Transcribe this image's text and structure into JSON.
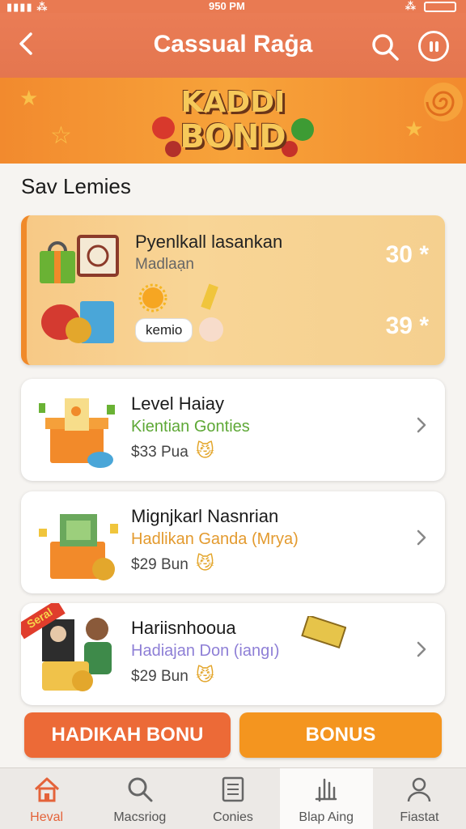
{
  "status_bar": {
    "time": "950 PM"
  },
  "header": {
    "title": "Cassual Raġa"
  },
  "banner": {
    "logo_line1": "KADDI",
    "logo_line2": "BOND"
  },
  "section_title": "Sav Lemies",
  "featured": {
    "title": "Pyenlkall lasankan",
    "subtitle": "Madlaạn",
    "chip_label": "kemio",
    "value_top": "30 *",
    "value_bottom": "39 *"
  },
  "offers": [
    {
      "title": "Level Haiay",
      "subtitle": "Kientian Gonties",
      "subtitle_color": "#5ea836",
      "price": "$33 Pua"
    },
    {
      "title": "Mignjkarl Nasnrian",
      "subtitle": "Hadlikan Ganda (Mrya)",
      "subtitle_color": "#e39a2e",
      "price": "$29 Bun"
    },
    {
      "title": "Hariisnhooua",
      "subtitle": "Hadiajan Don (iangı)",
      "subtitle_color": "#8e7fd6",
      "price": "$29 Bun",
      "ribbon": "Seral"
    }
  ],
  "buttons": {
    "left": "HADIKAH BONU",
    "right": "BONUS"
  },
  "tabs": [
    {
      "label": "Heval",
      "icon": "home-icon"
    },
    {
      "label": "Macsriog",
      "icon": "search-icon"
    },
    {
      "label": "Conies",
      "icon": "document-icon"
    },
    {
      "label": "Blap Aing",
      "icon": "hand-icon"
    },
    {
      "label": "Fiastat",
      "icon": "profile-icon"
    }
  ],
  "colors": {
    "header": "#e97a52",
    "accent": "#ec6a37",
    "bonus": "#f4951f"
  }
}
